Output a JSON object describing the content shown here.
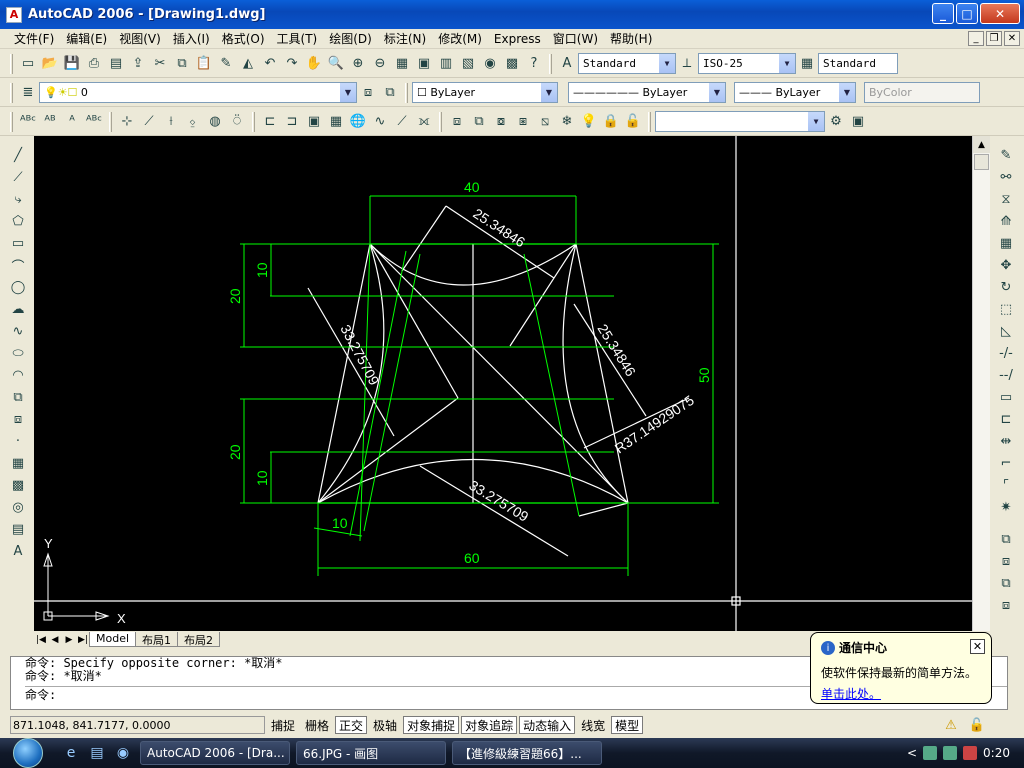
{
  "window": {
    "title": "AutoCAD 2006 - [Drawing1.dwg]",
    "app_icon": "autocad-icon"
  },
  "menu": [
    "文件(F)",
    "编辑(E)",
    "视图(V)",
    "插入(I)",
    "格式(O)",
    "工具(T)",
    "绘图(D)",
    "标注(N)",
    "修改(M)",
    "Express",
    "窗口(W)",
    "帮助(H)"
  ],
  "toolbars": {
    "text_style": "Standard",
    "dim_style": "ISO-25",
    "table_style": "Standard",
    "layer": "0",
    "color": "ByLayer",
    "linetype": "ByLayer",
    "lineweight": "ByLayer",
    "plotstyle": "ByColor"
  },
  "drawing": {
    "dimensions": [
      "40",
      "25.34846",
      "20",
      "10",
      "50",
      "33.275709",
      "25.34846",
      "R37.14929075",
      "20",
      "10",
      "33.275709",
      "10",
      "60"
    ],
    "ucs_x": "X",
    "ucs_y": "Y"
  },
  "layout_tabs": [
    "Model",
    "布局1",
    "布局2"
  ],
  "command": {
    "line1": "命令: Specify opposite corner: *取消*",
    "line2": "命令: *取消*",
    "prompt": "命令:"
  },
  "status": {
    "coords": "871.1048, 841.7177, 0.0000",
    "buttons": [
      "捕捉",
      "栅格",
      "正交",
      "极轴",
      "对象捕捉",
      "对象追踪",
      "动态输入",
      "线宽",
      "模型"
    ]
  },
  "balloon": {
    "title": "通信中心",
    "body": "使软件保持最新的简单方法。",
    "link": "单击此处。"
  },
  "taskbar": {
    "tasks": [
      "AutoCAD 2006 - [Dra...",
      "66.JPG - 画图",
      "【進修級練習題66】..."
    ],
    "clock": "0:20"
  },
  "colors": {
    "dim": "#00ff00",
    "geom": "#ffffff",
    "bg": "#000000"
  }
}
